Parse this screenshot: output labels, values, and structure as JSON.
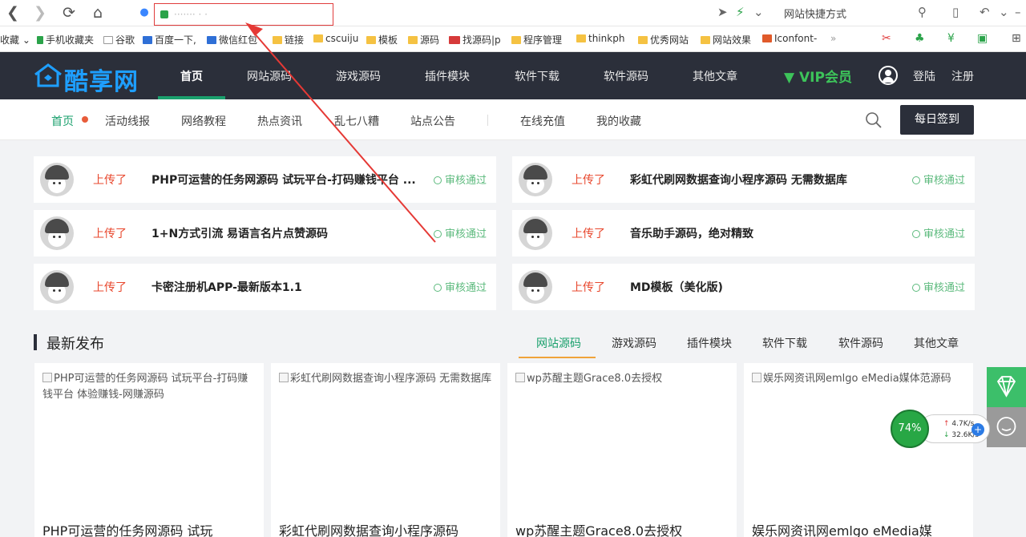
{
  "browser": {
    "url_display": "······· · ·",
    "shortcut_label": "网站快捷方式"
  },
  "bookmarks": [
    {
      "label": "收藏"
    },
    {
      "label": "手机收藏夹"
    },
    {
      "label": "谷歌"
    },
    {
      "label": "百度一下,"
    },
    {
      "label": "微信红包"
    },
    {
      "label": "链接"
    },
    {
      "label": "cscuiju"
    },
    {
      "label": "模板"
    },
    {
      "label": "源码"
    },
    {
      "label": "找源码|p"
    },
    {
      "label": "程序管理"
    },
    {
      "label": "thinkph"
    },
    {
      "label": "优秀网站"
    },
    {
      "label": "网站效果"
    },
    {
      "label": "Iconfont-"
    }
  ],
  "site": {
    "logo": "酷享网",
    "nav": [
      "首页",
      "网站源码",
      "游戏源码",
      "插件模块",
      "软件下载",
      "软件源码",
      "其他文章"
    ],
    "vip": "VIP会员",
    "login": "登陆",
    "register": "注册"
  },
  "subnav": {
    "items": [
      "首页",
      "活动线报",
      "网络教程",
      "热点资讯",
      "乱七八糟",
      "站点公告",
      "在线充值",
      "我的收藏"
    ],
    "sign_button": "每日签到"
  },
  "activity": [
    {
      "action": "上传了",
      "title": "PHP可运营的任务网源码 试玩平台-打码赚钱平台 ...",
      "status": "审核通过"
    },
    {
      "action": "上传了",
      "title": "彩虹代刷网数据查询小程序源码 无需数据库",
      "status": "审核通过"
    },
    {
      "action": "上传了",
      "title": "1+N方式引流 易语言名片点赞源码",
      "status": "审核通过"
    },
    {
      "action": "上传了",
      "title": "音乐助手源码，绝对精致",
      "status": "审核通过"
    },
    {
      "action": "上传了",
      "title": "卡密注册机APP-最新版本1.1",
      "status": "审核通过"
    },
    {
      "action": "上传了",
      "title": "MD模板（美化版)",
      "status": "审核通过"
    }
  ],
  "latest": {
    "heading": "最新发布",
    "tabs": [
      "网站源码",
      "游戏源码",
      "插件模块",
      "软件下载",
      "软件源码",
      "其他文章"
    ],
    "posts": [
      {
        "img_alt": "PHP可运营的任务网源码 试玩平台-打码赚钱平台 体验赚钱-网赚源码",
        "title": "PHP可运营的任务网源码 试玩"
      },
      {
        "img_alt": "彩虹代刷网数据查询小程序源码 无需数据库",
        "title": "彩虹代刷网数据查询小程序源码"
      },
      {
        "img_alt": "wp苏醒主题Grace8.0去授权",
        "title": "wp苏醒主题Grace8.0去授权"
      },
      {
        "img_alt": "娱乐网资讯网emlgo eMedia媒体范源码",
        "title": "娱乐网资讯网emlgo eMedia媒"
      }
    ]
  },
  "speed_widget": {
    "percent": "74%",
    "up": "4.7K/s",
    "down": "32.6K/s"
  }
}
